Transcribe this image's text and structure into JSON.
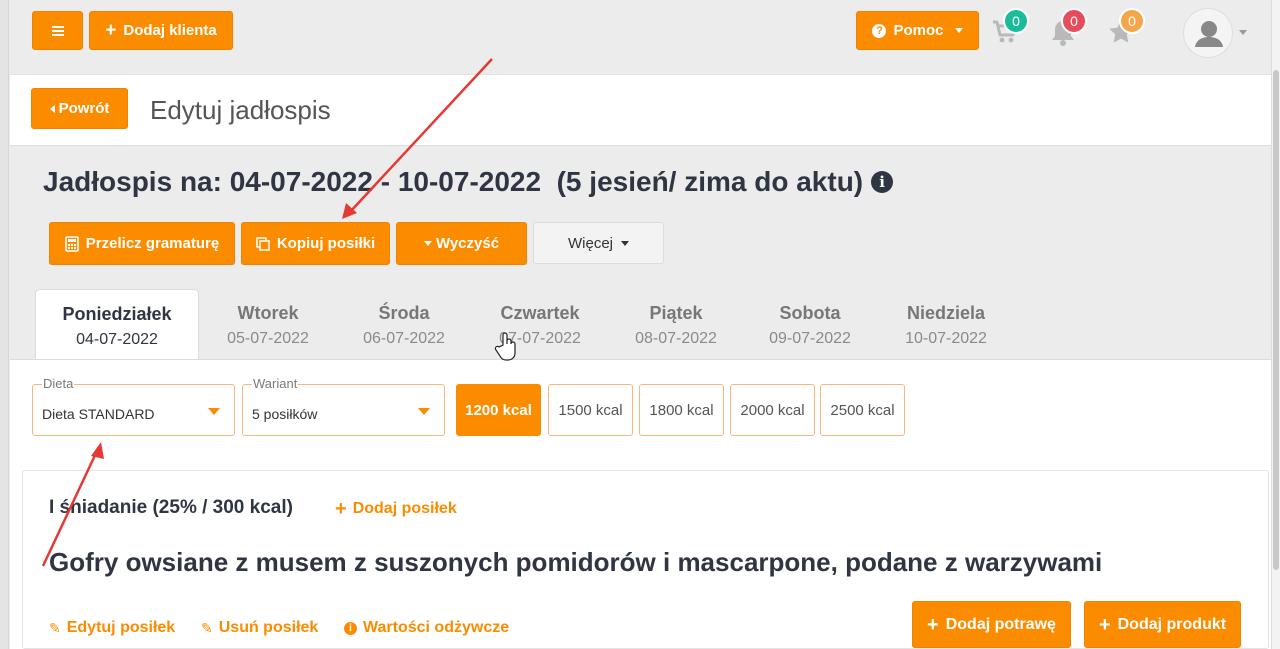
{
  "topbar": {
    "add_client_label": "Dodaj klienta",
    "help_label": "Pomoc",
    "cart_count": "0",
    "notifications_count": "0",
    "favorites_count": "0",
    "colors": {
      "accent": "#fb8c00",
      "cart_badge": "#1abc9c",
      "notif_badge": "#e74c5c",
      "fav_badge": "#f5a54a"
    }
  },
  "header": {
    "back_label": "Powrót",
    "title": "Edytuj jadłospis"
  },
  "menu": {
    "title": "Jadłospis na: 04-07-2022 - 10-07-2022  (5 jesień/ zima do aktu)",
    "actions": {
      "recalc_label": "Przelicz gramaturę",
      "copy_label": "Kopiuj posiłki",
      "clear_label": "Wyczyść",
      "more_label": "Więcej"
    }
  },
  "tabs": [
    {
      "day": "Poniedziałek",
      "date": "04-07-2022",
      "active": true
    },
    {
      "day": "Wtorek",
      "date": "05-07-2022"
    },
    {
      "day": "Środa",
      "date": "06-07-2022"
    },
    {
      "day": "Czwartek",
      "date": "07-07-2022"
    },
    {
      "day": "Piątek",
      "date": "08-07-2022"
    },
    {
      "day": "Sobota",
      "date": "09-07-2022"
    },
    {
      "day": "Niedziela",
      "date": "10-07-2022"
    }
  ],
  "filters": {
    "diet_label": "Dieta",
    "diet_value": "Dieta STANDARD",
    "variant_label": "Wariant",
    "variant_value": "5 posiłków",
    "kcal_options": [
      "1200 kcal",
      "1500 kcal",
      "1800 kcal",
      "2000 kcal",
      "2500 kcal"
    ],
    "kcal_selected": "1200 kcal"
  },
  "meal": {
    "section_title": "I śniadanie (25% / 300 kcal)",
    "add_meal_label": "Dodaj posiłek",
    "name": "Gofry owsiane z musem z suszonych pomidorów i mascarpone, podane z warzywami",
    "edit_label": "Edytuj posiłek",
    "delete_label": "Usuń posiłek",
    "nutrition_label": "Wartości odżywcze",
    "add_dish_label": "Dodaj potrawę",
    "add_product_label": "Dodaj produkt"
  }
}
